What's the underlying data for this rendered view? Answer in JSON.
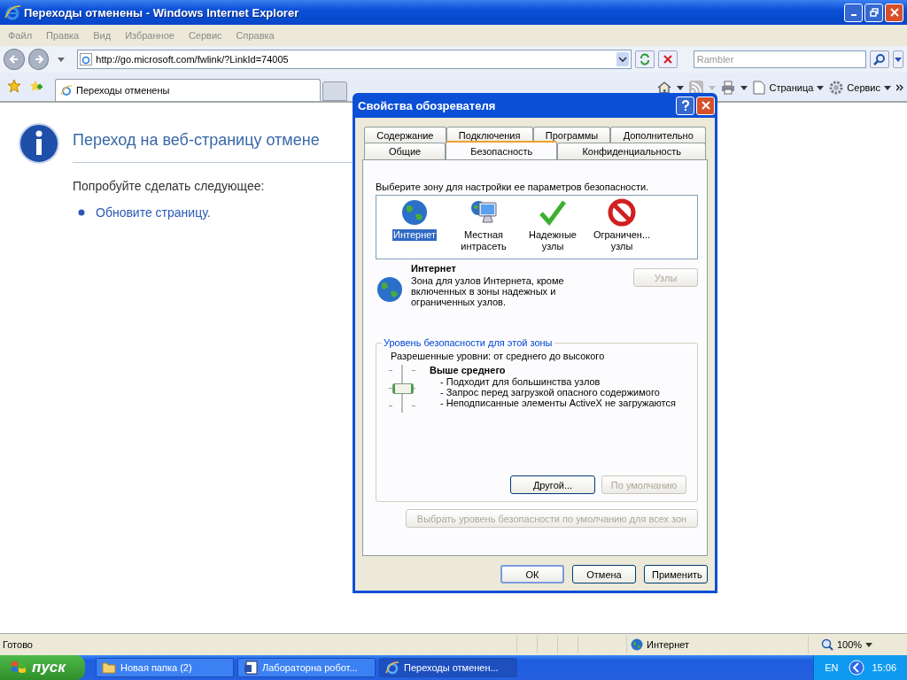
{
  "window": {
    "title": "Переходы отменены - Windows Internet Explorer"
  },
  "menu": [
    "Файл",
    "Правка",
    "Вид",
    "Избранное",
    "Сервис",
    "Справка"
  ],
  "address_bar": {
    "value": "http://go.microsoft.com/fwlink/?LinkId=74005"
  },
  "search": {
    "placeholder": "Rambler"
  },
  "browser_tabs": [
    {
      "label": "Переходы отменены",
      "selected": true
    }
  ],
  "command_bar": {
    "page_menu": "Страница",
    "tools_menu": "Сервис"
  },
  "page": {
    "heading": "Переход на веб-страницу отмене",
    "suggestion": "Попробуйте сделать следующее:",
    "links": [
      "Обновите страницу."
    ]
  },
  "dialog": {
    "title": "Свойства обозревателя",
    "tab_rows": [
      [
        {
          "label": "Содержание",
          "selected": false
        },
        {
          "label": "Подключения",
          "selected": false
        },
        {
          "label": "Программы",
          "selected": false
        },
        {
          "label": "Дополнительно",
          "selected": false
        }
      ],
      [
        {
          "label": "Общие",
          "selected": false
        },
        {
          "label": "Безопасность",
          "selected": true
        },
        {
          "label": "Конфиденциальность",
          "selected": false
        }
      ]
    ],
    "prompt": "Выберите зону для настройки ее параметров безопасности.",
    "zones": [
      {
        "label": "Интернет",
        "kind": "internet",
        "selected": true
      },
      {
        "label": "Местная\nинтрасеть",
        "kind": "intranet",
        "selected": false
      },
      {
        "label": "Надежные\nузлы",
        "kind": "trusted",
        "selected": false
      },
      {
        "label": "Ограничен...\nузлы",
        "kind": "restricted",
        "selected": false
      }
    ],
    "zone_info": {
      "title": "Интернет",
      "description": "Зона для узлов Интернета, кроме включенных в зоны надежных и ограниченных узлов."
    },
    "sites_button": {
      "label": "Узлы",
      "disabled": true
    },
    "security_group": {
      "title": "Уровень безопасности для этой зоны",
      "allowed": "Разрешенные уровни: от среднего до высокого",
      "slider": {
        "level": 0.5
      },
      "level_name": "Выше среднего",
      "bullets": [
        "- Подходит для большинства узлов",
        "- Запрос перед загрузкой опасного содержимого",
        "- Неподписанные элементы ActiveX не загружаются"
      ],
      "custom_button": {
        "label": "Другой...",
        "disabled": false
      },
      "default_button": {
        "label": "По умолчанию",
        "disabled": true
      }
    },
    "reset_all_button": {
      "label": "Выбрать уровень безопасности по умолчанию для всех зон",
      "disabled": true
    },
    "buttons": [
      {
        "label": "ОК",
        "default": true
      },
      {
        "label": "Отмена",
        "default": false
      },
      {
        "label": "Применить",
        "default": false
      }
    ]
  },
  "status_bar": {
    "text": "Готово",
    "zone": "Интернет",
    "zoom": "100%"
  },
  "taskbar": {
    "start": "пуск",
    "tasks": [
      {
        "label": "Новая папка (2)",
        "kind": "folder",
        "selected": false
      },
      {
        "label": "Лабораторна робот...",
        "kind": "document",
        "selected": false
      },
      {
        "label": "Переходы отменен...",
        "kind": "browser",
        "selected": true
      }
    ],
    "lang": "EN",
    "clock": "15:06"
  }
}
